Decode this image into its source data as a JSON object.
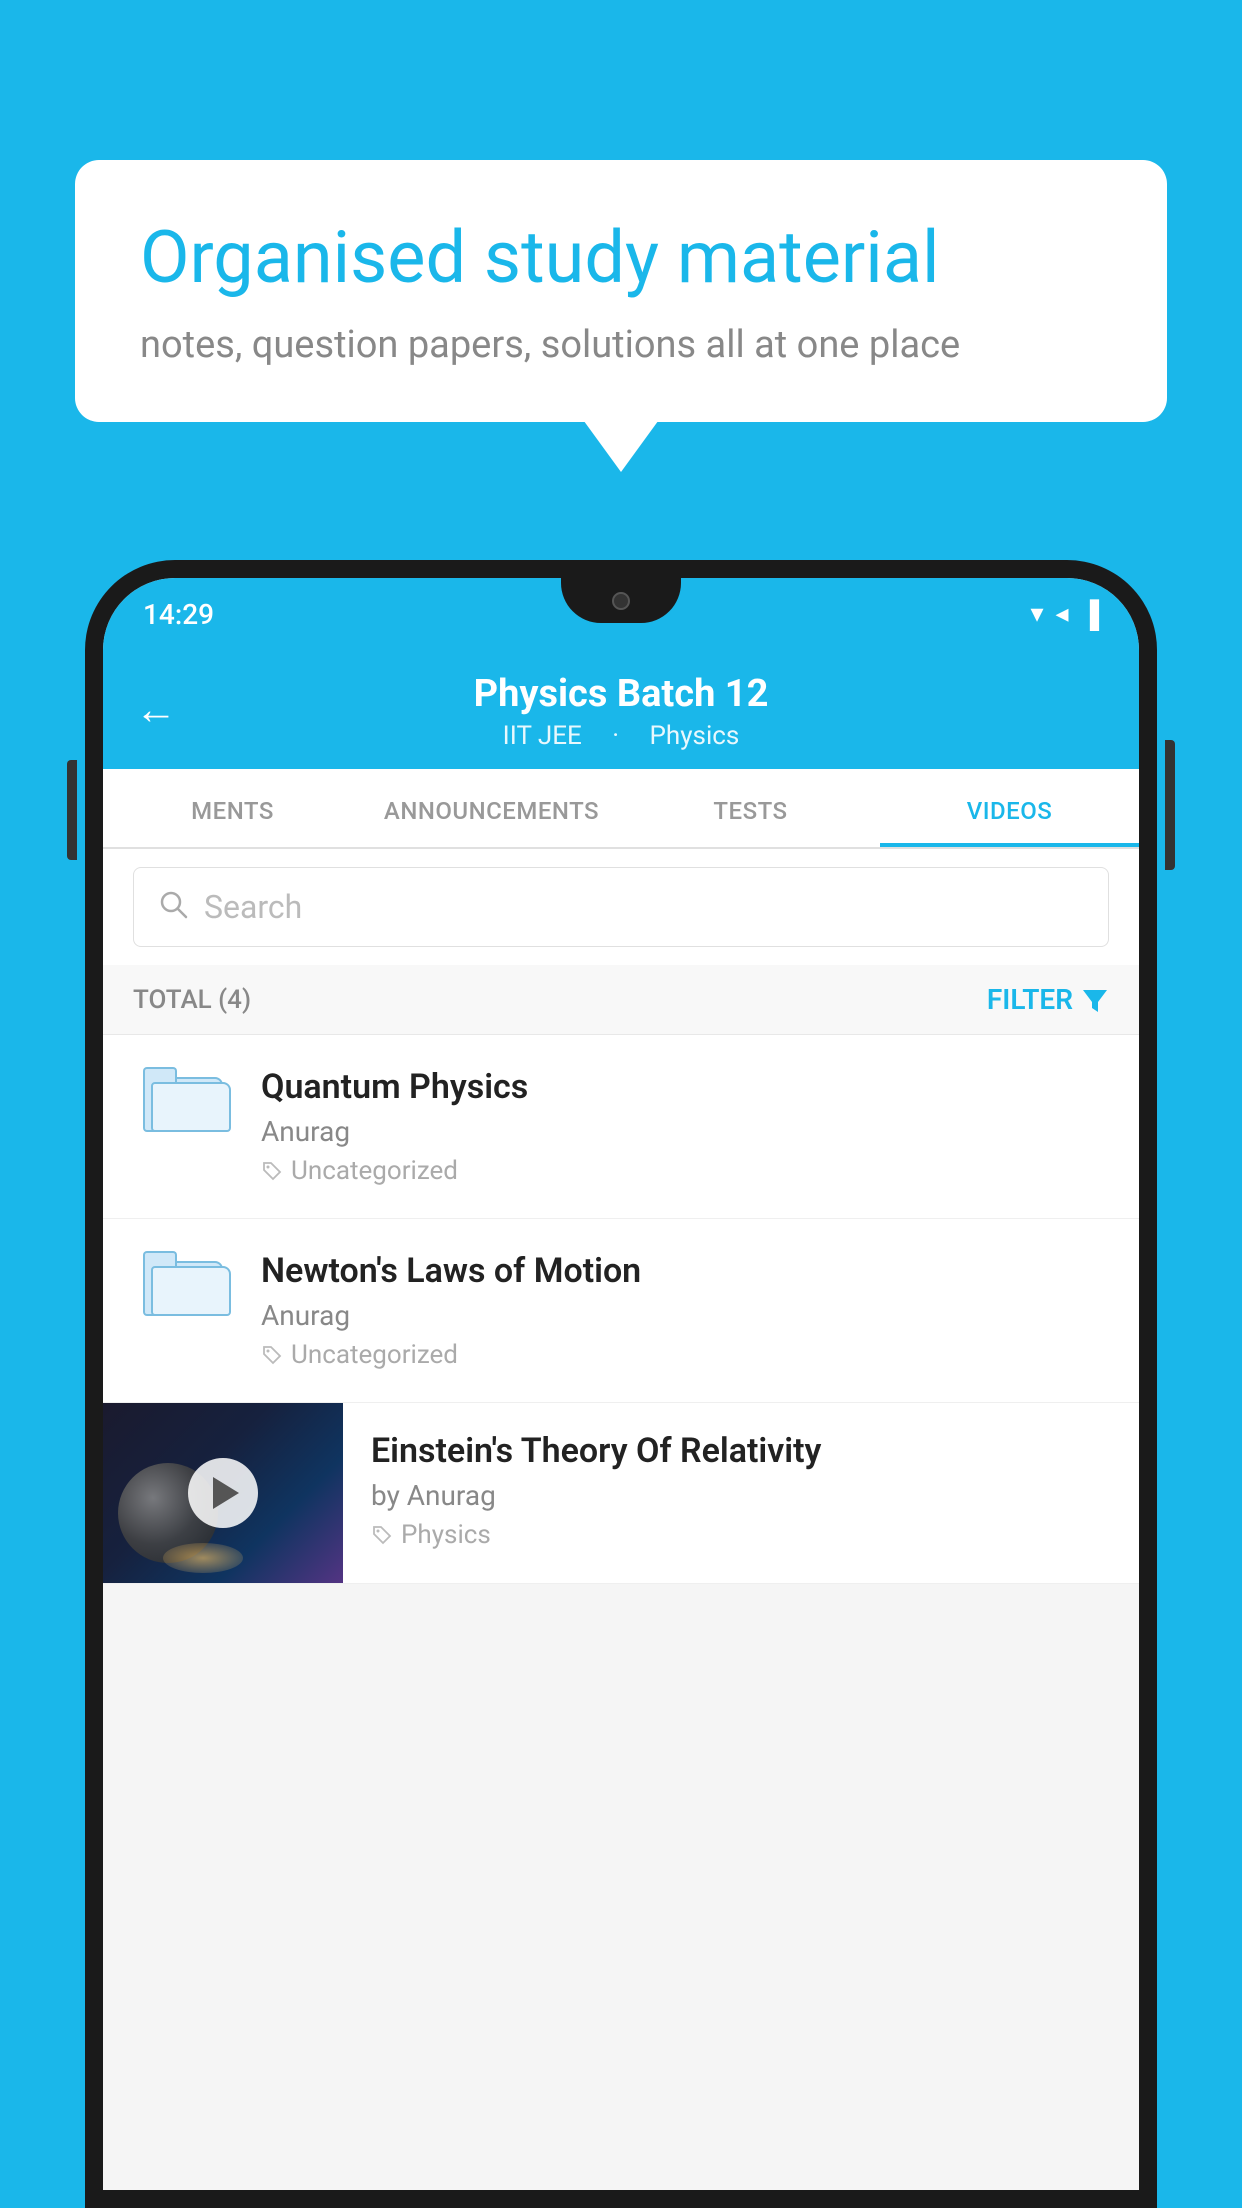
{
  "page": {
    "background_color": "#1ab7ea"
  },
  "bubble": {
    "title": "Organised study material",
    "subtitle": "notes, question papers, solutions all at one place"
  },
  "status_bar": {
    "time": "14:29",
    "wifi": "▾",
    "signal": "◂",
    "battery": "▌"
  },
  "header": {
    "back_label": "←",
    "title": "Physics Batch 12",
    "subtitle_part1": "IIT JEE",
    "subtitle_part2": "Physics"
  },
  "tabs": [
    {
      "label": "MENTS",
      "active": false
    },
    {
      "label": "ANNOUNCEMENTS",
      "active": false
    },
    {
      "label": "TESTS",
      "active": false
    },
    {
      "label": "VIDEOS",
      "active": true
    }
  ],
  "search": {
    "placeholder": "Search"
  },
  "filter_row": {
    "total_label": "TOTAL (4)",
    "filter_label": "FILTER"
  },
  "videos": [
    {
      "id": 1,
      "title": "Quantum Physics",
      "author": "Anurag",
      "tag": "Uncategorized",
      "has_thumbnail": false
    },
    {
      "id": 2,
      "title": "Newton's Laws of Motion",
      "author": "Anurag",
      "tag": "Uncategorized",
      "has_thumbnail": false
    },
    {
      "id": 3,
      "title": "Einstein's Theory Of Relativity",
      "author": "by Anurag",
      "tag": "Physics",
      "has_thumbnail": true
    }
  ]
}
